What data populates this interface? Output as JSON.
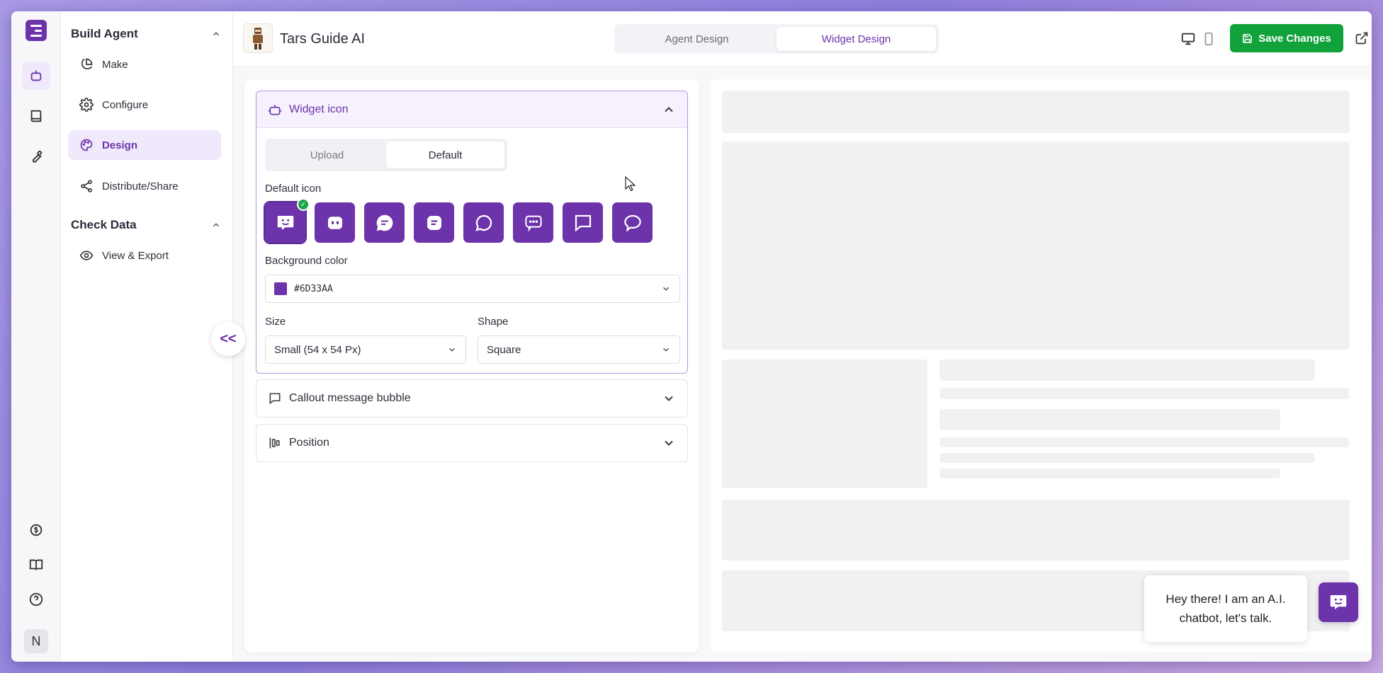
{
  "colors": {
    "accent": "#6D33AA",
    "save": "#12A23C",
    "check": "#19A54A"
  },
  "rail": {
    "items": [
      "agent-icon",
      "book-icon",
      "wrench-icon"
    ],
    "bottom": [
      "billing-icon",
      "docs-icon",
      "help-icon"
    ],
    "user_initial": "N"
  },
  "sidebar": {
    "build_agent": "Build Agent",
    "items": [
      {
        "label": "Make",
        "icon": "pie-chart-icon"
      },
      {
        "label": "Configure",
        "icon": "gear-icon"
      },
      {
        "label": "Design",
        "icon": "palette-icon",
        "active": true
      },
      {
        "label": "Distribute/Share",
        "icon": "share-icon"
      }
    ],
    "check_data": "Check Data",
    "check_items": [
      {
        "label": "View & Export",
        "icon": "eye-icon"
      }
    ],
    "collapse_glyph": "<<"
  },
  "header": {
    "agent_name": "Tars Guide AI",
    "tabs": [
      "Agent Design",
      "Widget Design"
    ],
    "active_tab": "Widget Design",
    "save_label": "Save Changes"
  },
  "widget_icon": {
    "title": "Widget icon",
    "tabs": [
      "Upload",
      "Default"
    ],
    "active_tab": "Default",
    "default_icon_label": "Default icon",
    "icons": [
      "smile-chat-icon",
      "robot-face-icon",
      "chat-lines-icon",
      "square-chat-icon",
      "round-bubble-icon",
      "dots-bubble-icon",
      "square-bubble-icon",
      "oval-bubble-icon"
    ],
    "selected_icon": 0,
    "background_color_label": "Background color",
    "background_color": "#6D33AA",
    "size_label": "Size",
    "size_value": "Small (54 x 54 Px)",
    "shape_label": "Shape",
    "shape_value": "Square"
  },
  "sections": {
    "callout": "Callout message bubble",
    "position": "Position"
  },
  "preview": {
    "callout_text": "Hey there! I am an A.I. chatbot, let's talk."
  }
}
